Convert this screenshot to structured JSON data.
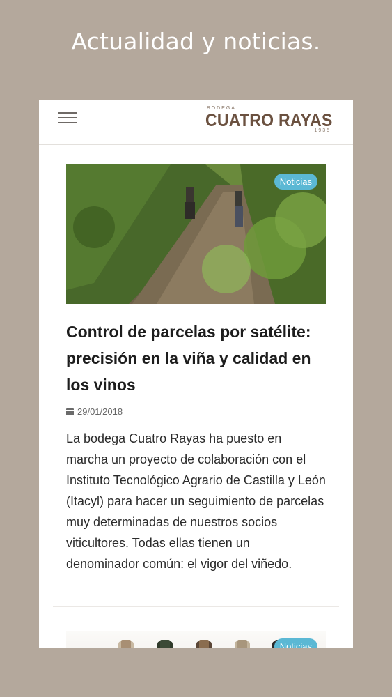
{
  "promo": {
    "title": "Actualidad y noticias."
  },
  "header": {
    "logo": {
      "top": "BODEGA",
      "main": "CUATRO RAYAS",
      "year": "1935"
    }
  },
  "articles": [
    {
      "badge": "Noticias",
      "title": "Control de parcelas por satélite: precisión en la viña y calidad en los vinos",
      "date": "29/01/2018",
      "excerpt": "La bodega Cuatro Rayas ha puesto en marcha un proyecto de colaboración con el Instituto Tecnológico Agrario de Castilla y León (Itacyl) para hacer un seguimiento de parcelas muy determinadas de nuestros socios viticultores. Todas ellas tienen un denominador común: el vigor del viñedo."
    },
    {
      "badge": "Noticias"
    }
  ],
  "icons": {
    "menu": "hamburger-icon",
    "date": "calendar-icon"
  },
  "colors": {
    "background": "#b4a89c",
    "badge": "#5bb8d4",
    "brand": "#6b5140"
  }
}
